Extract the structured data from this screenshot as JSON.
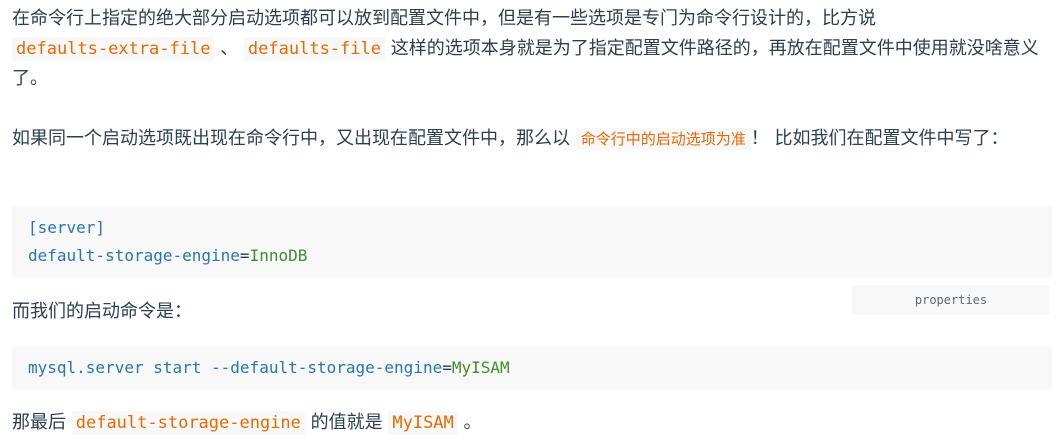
{
  "para1": {
    "line1": "在命令行上指定的绝大部分启动选项都可以放到配置文件中，但是有一些选项是专门为命令行设计的，比方说",
    "code1": "defaults-extra-file",
    "sep": " 、 ",
    "code2": "defaults-file",
    "rest": " 这样的选项本身就是为了指定配置文件路径的，再放在配置文件中使用就没啥意义了。"
  },
  "para2": {
    "before": "如果同一个启动选项既出现在命令行中，又出现在配置文件中，那么以 ",
    "highlight": "命令行中的启动选项为准",
    "after": "！ 比如我们在配置文件中写了："
  },
  "codeblock1": {
    "section": "[server]",
    "key": "default-storage-engine",
    "eq": "=",
    "value": "InnoDB"
  },
  "lang_badge": "properties",
  "para3": "而我们的启动命令是：",
  "codeblock2": {
    "command": "mysql.server start --default-storage-engine",
    "eq": "=",
    "value": "MyISAM"
  },
  "para4": {
    "before": "那最后 ",
    "code1": "default-storage-engine",
    "middle": " 的值就是 ",
    "code2": "MyISAM",
    "after": " 。"
  },
  "colors": {
    "text": "#2c3e50",
    "inline_code": "#e96900",
    "code_bg": "#f8f8f8",
    "keyword": "#2973b7",
    "value": "#3e8f2e"
  }
}
